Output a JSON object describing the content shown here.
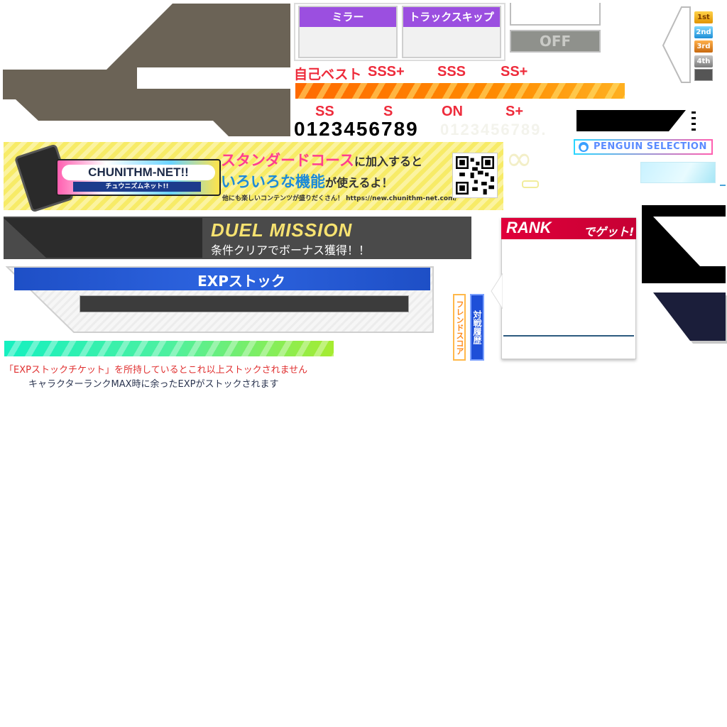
{
  "options": {
    "mirror_label": "ミラー",
    "track_skip_label": "トラックスキップ",
    "off_label": "OFF"
  },
  "ranks": {
    "self_best": "自己ベスト",
    "sss_plus": "SSS+",
    "sss": "SSS",
    "ss_plus": "SS+",
    "ss": "SS",
    "s": "S",
    "on": "ON",
    "s_plus": "S+"
  },
  "digits": {
    "black": "0123456789",
    "faint": "0123456789."
  },
  "placements": [
    "1st",
    "2nd",
    "3rd",
    "4th"
  ],
  "penguin_label": "PENGUIN SELECTION",
  "infinity": "∞",
  "banner": {
    "logo_title": "CHUNITHM-NET!!",
    "logo_sub": "チュウニズムネット!!",
    "line1_emph": "スタンダードコース",
    "line1_rest": "に加入すると",
    "line2_emph": "いろいろな機能",
    "line2_rest": "が使えるよ！",
    "small": "他にも楽しいコンテンツが盛りだくさん！ https://new.chunithm-net.com/"
  },
  "duel": {
    "title": "DUEL MISSION",
    "subtitle": "条件クリアでボーナス獲得！！"
  },
  "exp": {
    "title": "EXPストック",
    "note_red": "「EXPストックチケット」を所持しているとこれ以上ストックされません",
    "note_dark": "キャラクターランクMAX時に余ったEXPがストックされます"
  },
  "tabs": {
    "friend_score": "フレンドスコア",
    "battle_history": "対戦履歴"
  },
  "rank_card": {
    "rank_word": "RANK",
    "get_word": "でゲット!"
  },
  "colors": {
    "brown": "#6b6356",
    "purple": "#9b4fe0",
    "rank_red": "#ee2b3b",
    "exp_blue": "#1e4fc6",
    "rank_crimson": "#e0003a"
  }
}
